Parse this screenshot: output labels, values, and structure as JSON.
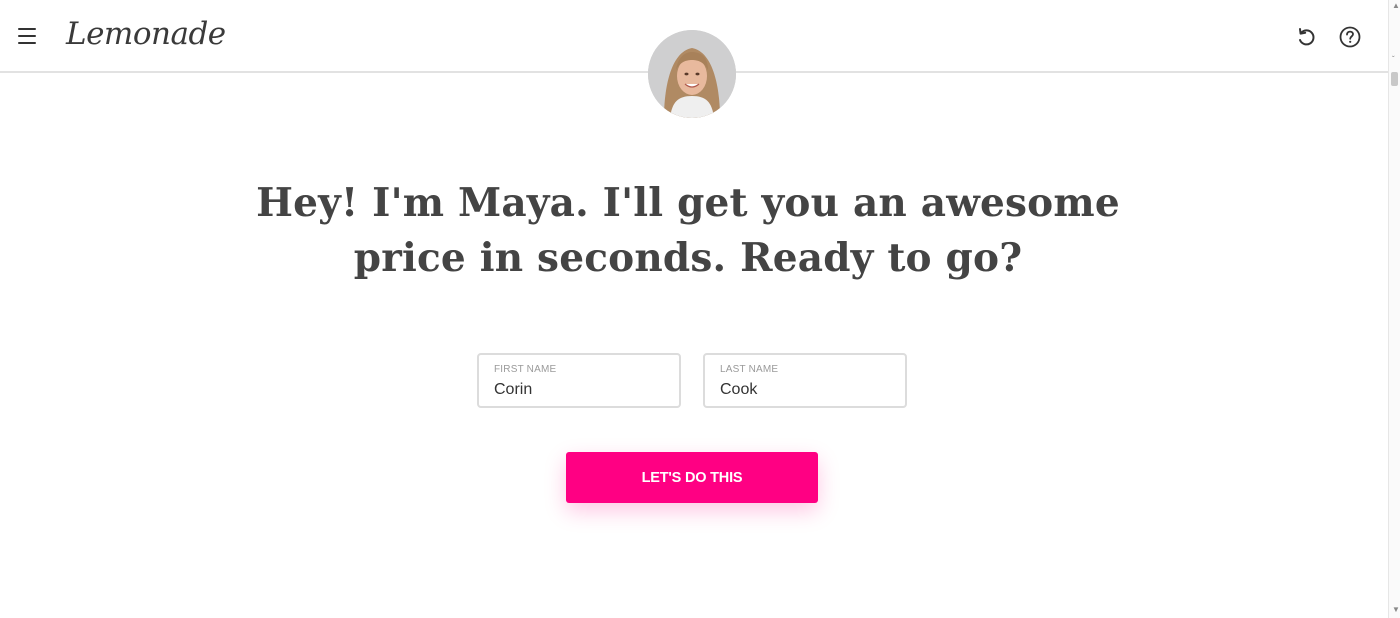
{
  "header": {
    "logo_text": "Lemonade",
    "menu_icon": "hamburger-menu-icon",
    "undo_icon": "undo-icon",
    "help_icon": "help-icon"
  },
  "assistant": {
    "avatar_icon": "avatar-photo"
  },
  "headline": {
    "line1": "Hey! I'm Maya. I'll get you an awesome",
    "line2": "price in seconds. Ready to go?"
  },
  "form": {
    "first_name": {
      "label": "FIRST NAME",
      "value": "Corin"
    },
    "last_name": {
      "label": "LAST NAME",
      "value": "Cook"
    },
    "submit_label": "LET'S DO THIS"
  },
  "colors": {
    "accent": "#ff0083",
    "text": "#444444",
    "border": "#dcdcdc"
  }
}
